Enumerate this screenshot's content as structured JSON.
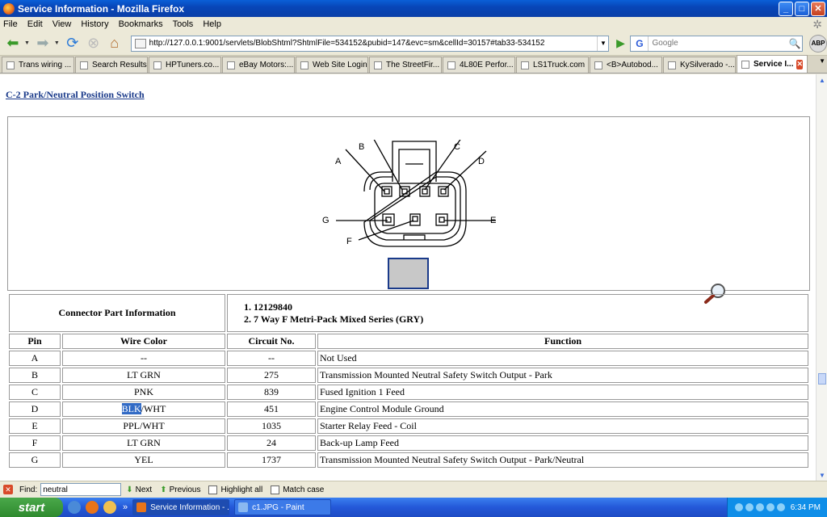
{
  "window": {
    "title": "Service Information - Mozilla Firefox"
  },
  "menu": [
    "File",
    "Edit",
    "View",
    "History",
    "Bookmarks",
    "Tools",
    "Help"
  ],
  "nav": {
    "url": "http://127.0.0.1:9001/servlets/BlobShtml?ShtmlFile=534152&pubid=147&evc=sm&cellId=30157#tab33-534152",
    "search_engine": "G",
    "search_placeholder": "Google",
    "adblock_label": "ABP"
  },
  "tabs": [
    {
      "label": "Trans wiring ..."
    },
    {
      "label": "Search Results"
    },
    {
      "label": "HPTuners.co..."
    },
    {
      "label": "eBay Motors:..."
    },
    {
      "label": "Web Site Login"
    },
    {
      "label": "The StreetFir..."
    },
    {
      "label": "4L80E Perfor..."
    },
    {
      "label": "LS1Truck.com"
    },
    {
      "label": "<B>Autobod..."
    },
    {
      "label": "KySilverado -..."
    },
    {
      "label": "Service I..."
    }
  ],
  "page": {
    "heading": "C-2 Park/Neutral Position Switch",
    "diagram_pins": {
      "A": "A",
      "B": "B",
      "C": "C",
      "D": "D",
      "E": "E",
      "F": "F",
      "G": "G"
    },
    "connector_part_label": "Connector Part Information",
    "connector_part_items": [
      "12129840",
      "7 Way F Metri-Pack Mixed Series (GRY)"
    ],
    "columns": {
      "pin": "Pin",
      "wire_color": "Wire Color",
      "circuit": "Circuit No.",
      "function": "Function"
    },
    "rows": [
      {
        "pin": "A",
        "wire_color": "--",
        "circuit": "--",
        "function": "Not Used"
      },
      {
        "pin": "B",
        "wire_color": "LT GRN",
        "circuit": "275",
        "function": "Transmission Mounted Neutral Safety Switch Output - Park"
      },
      {
        "pin": "C",
        "wire_color": "PNK",
        "circuit": "839",
        "function": "Fused Ignition 1 Feed"
      },
      {
        "pin": "D",
        "wire_color_hl": "BLK",
        "wire_color_rest": "/WHT",
        "circuit": "451",
        "function": "Engine Control Module Ground"
      },
      {
        "pin": "E",
        "wire_color": "PPL/WHT",
        "circuit": "1035",
        "function": "Starter Relay Feed - Coil"
      },
      {
        "pin": "F",
        "wire_color": "LT GRN",
        "circuit": "24",
        "function": "Back-up Lamp Feed"
      },
      {
        "pin": "G",
        "wire_color": "YEL",
        "circuit": "1737",
        "function": "Transmission Mounted Neutral Safety Switch Output - Park/Neutral"
      }
    ]
  },
  "findbar": {
    "label": "Find:",
    "value": "neutral",
    "next": "Next",
    "previous": "Previous",
    "highlight_all": "Highlight all",
    "match_case": "Match case"
  },
  "taskbar": {
    "start": "start",
    "tasks": [
      {
        "label": "Service Information - ..."
      },
      {
        "label": "c1.JPG - Paint"
      }
    ],
    "overflow": "»",
    "clock": "6:34 PM"
  },
  "colors": {
    "selection": "#316ac5",
    "heading_link": "#1a3a8a"
  }
}
